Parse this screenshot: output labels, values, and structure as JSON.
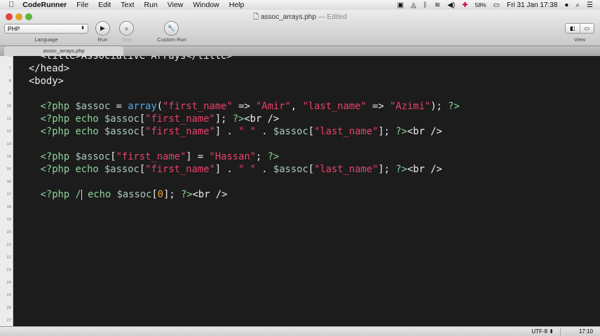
{
  "menubar": {
    "app": "CodeRunner",
    "items": [
      "File",
      "Edit",
      "Text",
      "Run",
      "View",
      "Window",
      "Help"
    ],
    "battery": "58%",
    "clock": "Fri 31 Jan  17:38"
  },
  "window": {
    "filename": "assoc_arrays.php",
    "edited": "— Edited"
  },
  "toolbar": {
    "language_value": "PHP",
    "language_label": "Language",
    "run": "Run",
    "stop": "Stop",
    "custom_run": "Custom Run",
    "view": "View"
  },
  "tab": {
    "label": "assoc_arrays.php"
  },
  "editor": {
    "first_line": 6,
    "last_line": 27,
    "lines": {
      "6": [
        [
          "  <title>Associative Arrays</title>",
          "tag"
        ]
      ],
      "7": [
        [
          "</head>",
          "tag"
        ]
      ],
      "8": [
        [
          "<body>",
          "tag"
        ]
      ],
      "10": [
        [
          "  <?php ",
          "php"
        ],
        [
          "$assoc",
          "var"
        ],
        [
          " = ",
          "op"
        ],
        [
          "array",
          "fn"
        ],
        [
          "(",
          "op"
        ],
        [
          "\"first_name\"",
          "str"
        ],
        [
          " => ",
          "op"
        ],
        [
          "\"Amir\"",
          "str"
        ],
        [
          ", ",
          "op"
        ],
        [
          "\"last_name\"",
          "str"
        ],
        [
          " => ",
          "op"
        ],
        [
          "\"Azimi\"",
          "str"
        ],
        [
          "); ",
          "op"
        ],
        [
          "?>",
          "php"
        ]
      ],
      "11": [
        [
          "  <?php echo ",
          "php"
        ],
        [
          "$assoc",
          "var"
        ],
        [
          "[",
          "op"
        ],
        [
          "\"first_name\"",
          "str"
        ],
        [
          "]; ",
          "op"
        ],
        [
          "?>",
          "php"
        ],
        [
          "<br />",
          "tag"
        ]
      ],
      "12": [
        [
          "  <?php echo ",
          "php"
        ],
        [
          "$assoc",
          "var"
        ],
        [
          "[",
          "op"
        ],
        [
          "\"first_name\"",
          "str"
        ],
        [
          "] . ",
          "op"
        ],
        [
          "\" \"",
          "str"
        ],
        [
          " . ",
          "op"
        ],
        [
          "$assoc",
          "var"
        ],
        [
          "[",
          "op"
        ],
        [
          "\"last_name\"",
          "str"
        ],
        [
          "]; ",
          "op"
        ],
        [
          "?>",
          "php"
        ],
        [
          "<br />",
          "tag"
        ]
      ],
      "14": [
        [
          "  <?php ",
          "php"
        ],
        [
          "$assoc",
          "var"
        ],
        [
          "[",
          "op"
        ],
        [
          "\"first_name\"",
          "str"
        ],
        [
          "] = ",
          "op"
        ],
        [
          "\"Hassan\"",
          "str"
        ],
        [
          "; ",
          "op"
        ],
        [
          "?>",
          "php"
        ]
      ],
      "15": [
        [
          "  <?php echo ",
          "php"
        ],
        [
          "$assoc",
          "var"
        ],
        [
          "[",
          "op"
        ],
        [
          "\"first_name\"",
          "str"
        ],
        [
          "] . ",
          "op"
        ],
        [
          "\" \"",
          "str"
        ],
        [
          " . ",
          "op"
        ],
        [
          "$assoc",
          "var"
        ],
        [
          "[",
          "op"
        ],
        [
          "\"last_name\"",
          "str"
        ],
        [
          "]; ",
          "op"
        ],
        [
          "?>",
          "php"
        ],
        [
          "<br />",
          "tag"
        ]
      ],
      "17": [
        [
          "  <?php /",
          "php"
        ],
        [
          "|CURSOR|",
          "cursor"
        ],
        [
          " echo ",
          "php"
        ],
        [
          "$assoc",
          "var"
        ],
        [
          "[",
          "op"
        ],
        [
          "0",
          "num"
        ],
        [
          "]; ",
          "op"
        ],
        [
          "?>",
          "php"
        ],
        [
          "<br />",
          "tag"
        ]
      ]
    }
  },
  "status": {
    "encoding": "UTF-8",
    "position": "17:10"
  }
}
